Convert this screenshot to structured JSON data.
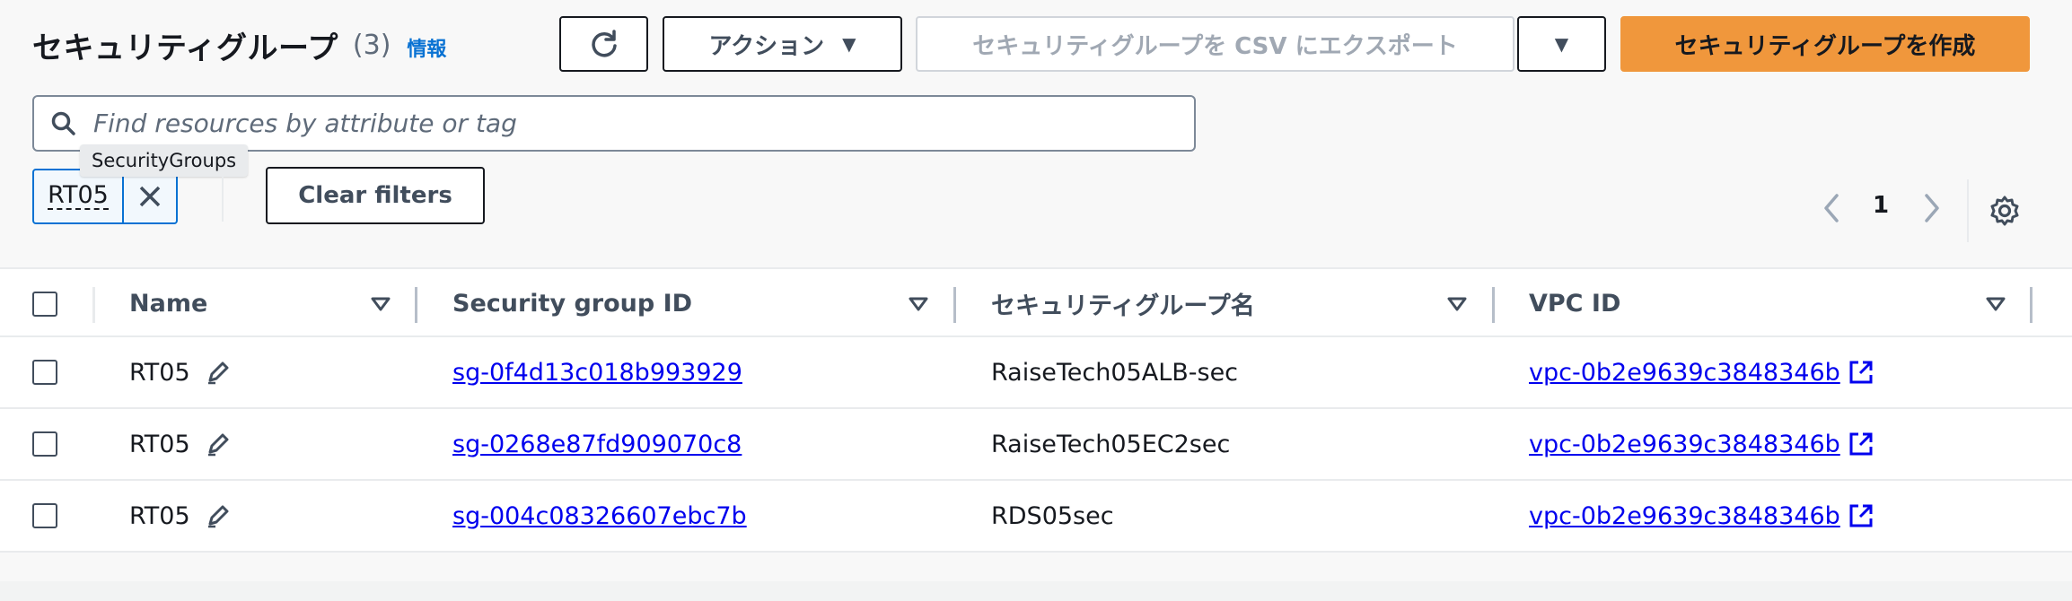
{
  "header": {
    "title": "セキュリティグループ",
    "count": "(3)",
    "info": "情報"
  },
  "toolbar": {
    "actions_label": "アクション",
    "export_label": "セキュリティグループを CSV にエクスポート",
    "create_label": "セキュリティグループを作成"
  },
  "search": {
    "placeholder": "Find resources by attribute or tag"
  },
  "filter": {
    "tooltip": "SecurityGroups",
    "token": "RT05",
    "clear_label": "Clear filters"
  },
  "pagination": {
    "current": "1"
  },
  "table": {
    "columns": [
      "Name",
      "Security group ID",
      "セキュリティグループ名",
      "VPC ID"
    ],
    "rows": [
      {
        "name": "RT05",
        "sg_id": "sg-0f4d13c018b993929",
        "sg_name": "RaiseTech05ALB-sec",
        "vpc": "vpc-0b2e9639c3848346b"
      },
      {
        "name": "RT05",
        "sg_id": "sg-0268e87fd909070c8",
        "sg_name": "RaiseTech05EC2sec",
        "vpc": "vpc-0b2e9639c3848346b"
      },
      {
        "name": "RT05",
        "sg_id": "sg-004c08326607ebc7b",
        "sg_name": "RDS05sec",
        "vpc": "vpc-0b2e9639c3848346b"
      }
    ]
  },
  "colors": {
    "primary": "#f0973c",
    "link": "#0000ee",
    "info": "#0972d3"
  },
  "icons": [
    "refresh-icon",
    "caret-down-icon",
    "search-icon",
    "close-icon",
    "chevron-left-icon",
    "chevron-right-icon",
    "gear-icon",
    "sort-icon",
    "edit-icon",
    "external-link-icon"
  ]
}
